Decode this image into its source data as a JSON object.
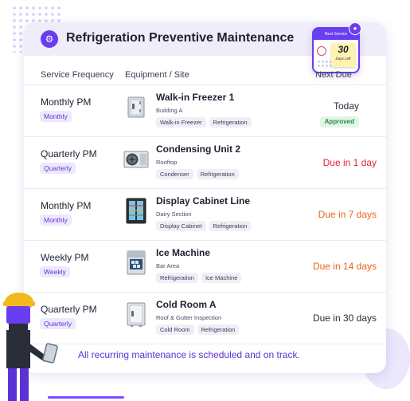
{
  "header": {
    "title": "Refrigeration Preventive Maintenance",
    "calendar": {
      "banner": "Next Service",
      "days_number": "30",
      "days_label": "Days Left"
    }
  },
  "columns": [
    "Service Frequency",
    "Equipment / Site",
    "Next Due"
  ],
  "rows": [
    {
      "frequency": "Monthly PM",
      "frequency_badge": "Monthly",
      "equipment": "Walk-in Freezer 1",
      "site": "Building A",
      "tags": [
        "Walk-in Freezer",
        "Refrigeration"
      ],
      "icon": "walk-in-freezer-icon",
      "next_due": "Today",
      "status": "Approved"
    },
    {
      "frequency": "Quarterly PM",
      "frequency_badge": "Quarterly",
      "equipment": "Condensing Unit 2",
      "site": "Rooftop",
      "tags": [
        "Condenser",
        "Refrigeration"
      ],
      "icon": "condensing-unit-icon",
      "next_due": "Due in 1 day"
    },
    {
      "frequency": "Monthly PM",
      "frequency_badge": "Monthly",
      "equipment": "Display Cabinet Line",
      "site": "Dairy Section",
      "tags": [
        "Display Cabinet",
        "Refrigeration"
      ],
      "icon": "display-cabinet-icon",
      "next_due": "Due in 7 days"
    },
    {
      "frequency": "Weekly PM",
      "frequency_badge": "Weekly",
      "equipment": "Ice Machine",
      "site": "Bar Area",
      "tags": [
        "Refrigeration",
        "Ice Machine"
      ],
      "icon": "ice-machine-icon",
      "next_due": "Due in 14 days"
    },
    {
      "frequency": "Quarterly PM",
      "frequency_badge": "Quarterly",
      "equipment": "Cold Room A",
      "site": "Roof & Gutter Inspection",
      "tags": [
        "Cold Room",
        "Refrigeration"
      ],
      "icon": "cold-room-icon",
      "next_due": "Due in 30 days"
    }
  ],
  "footer": "All recurring maintenance is scheduled and on track.",
  "colors": {
    "accent": "#6a3df0",
    "due_red": "#e0262b",
    "due_orange": "#e8651a",
    "due_neutral": "#2a2c40",
    "approved_green": "#2c8a46"
  }
}
